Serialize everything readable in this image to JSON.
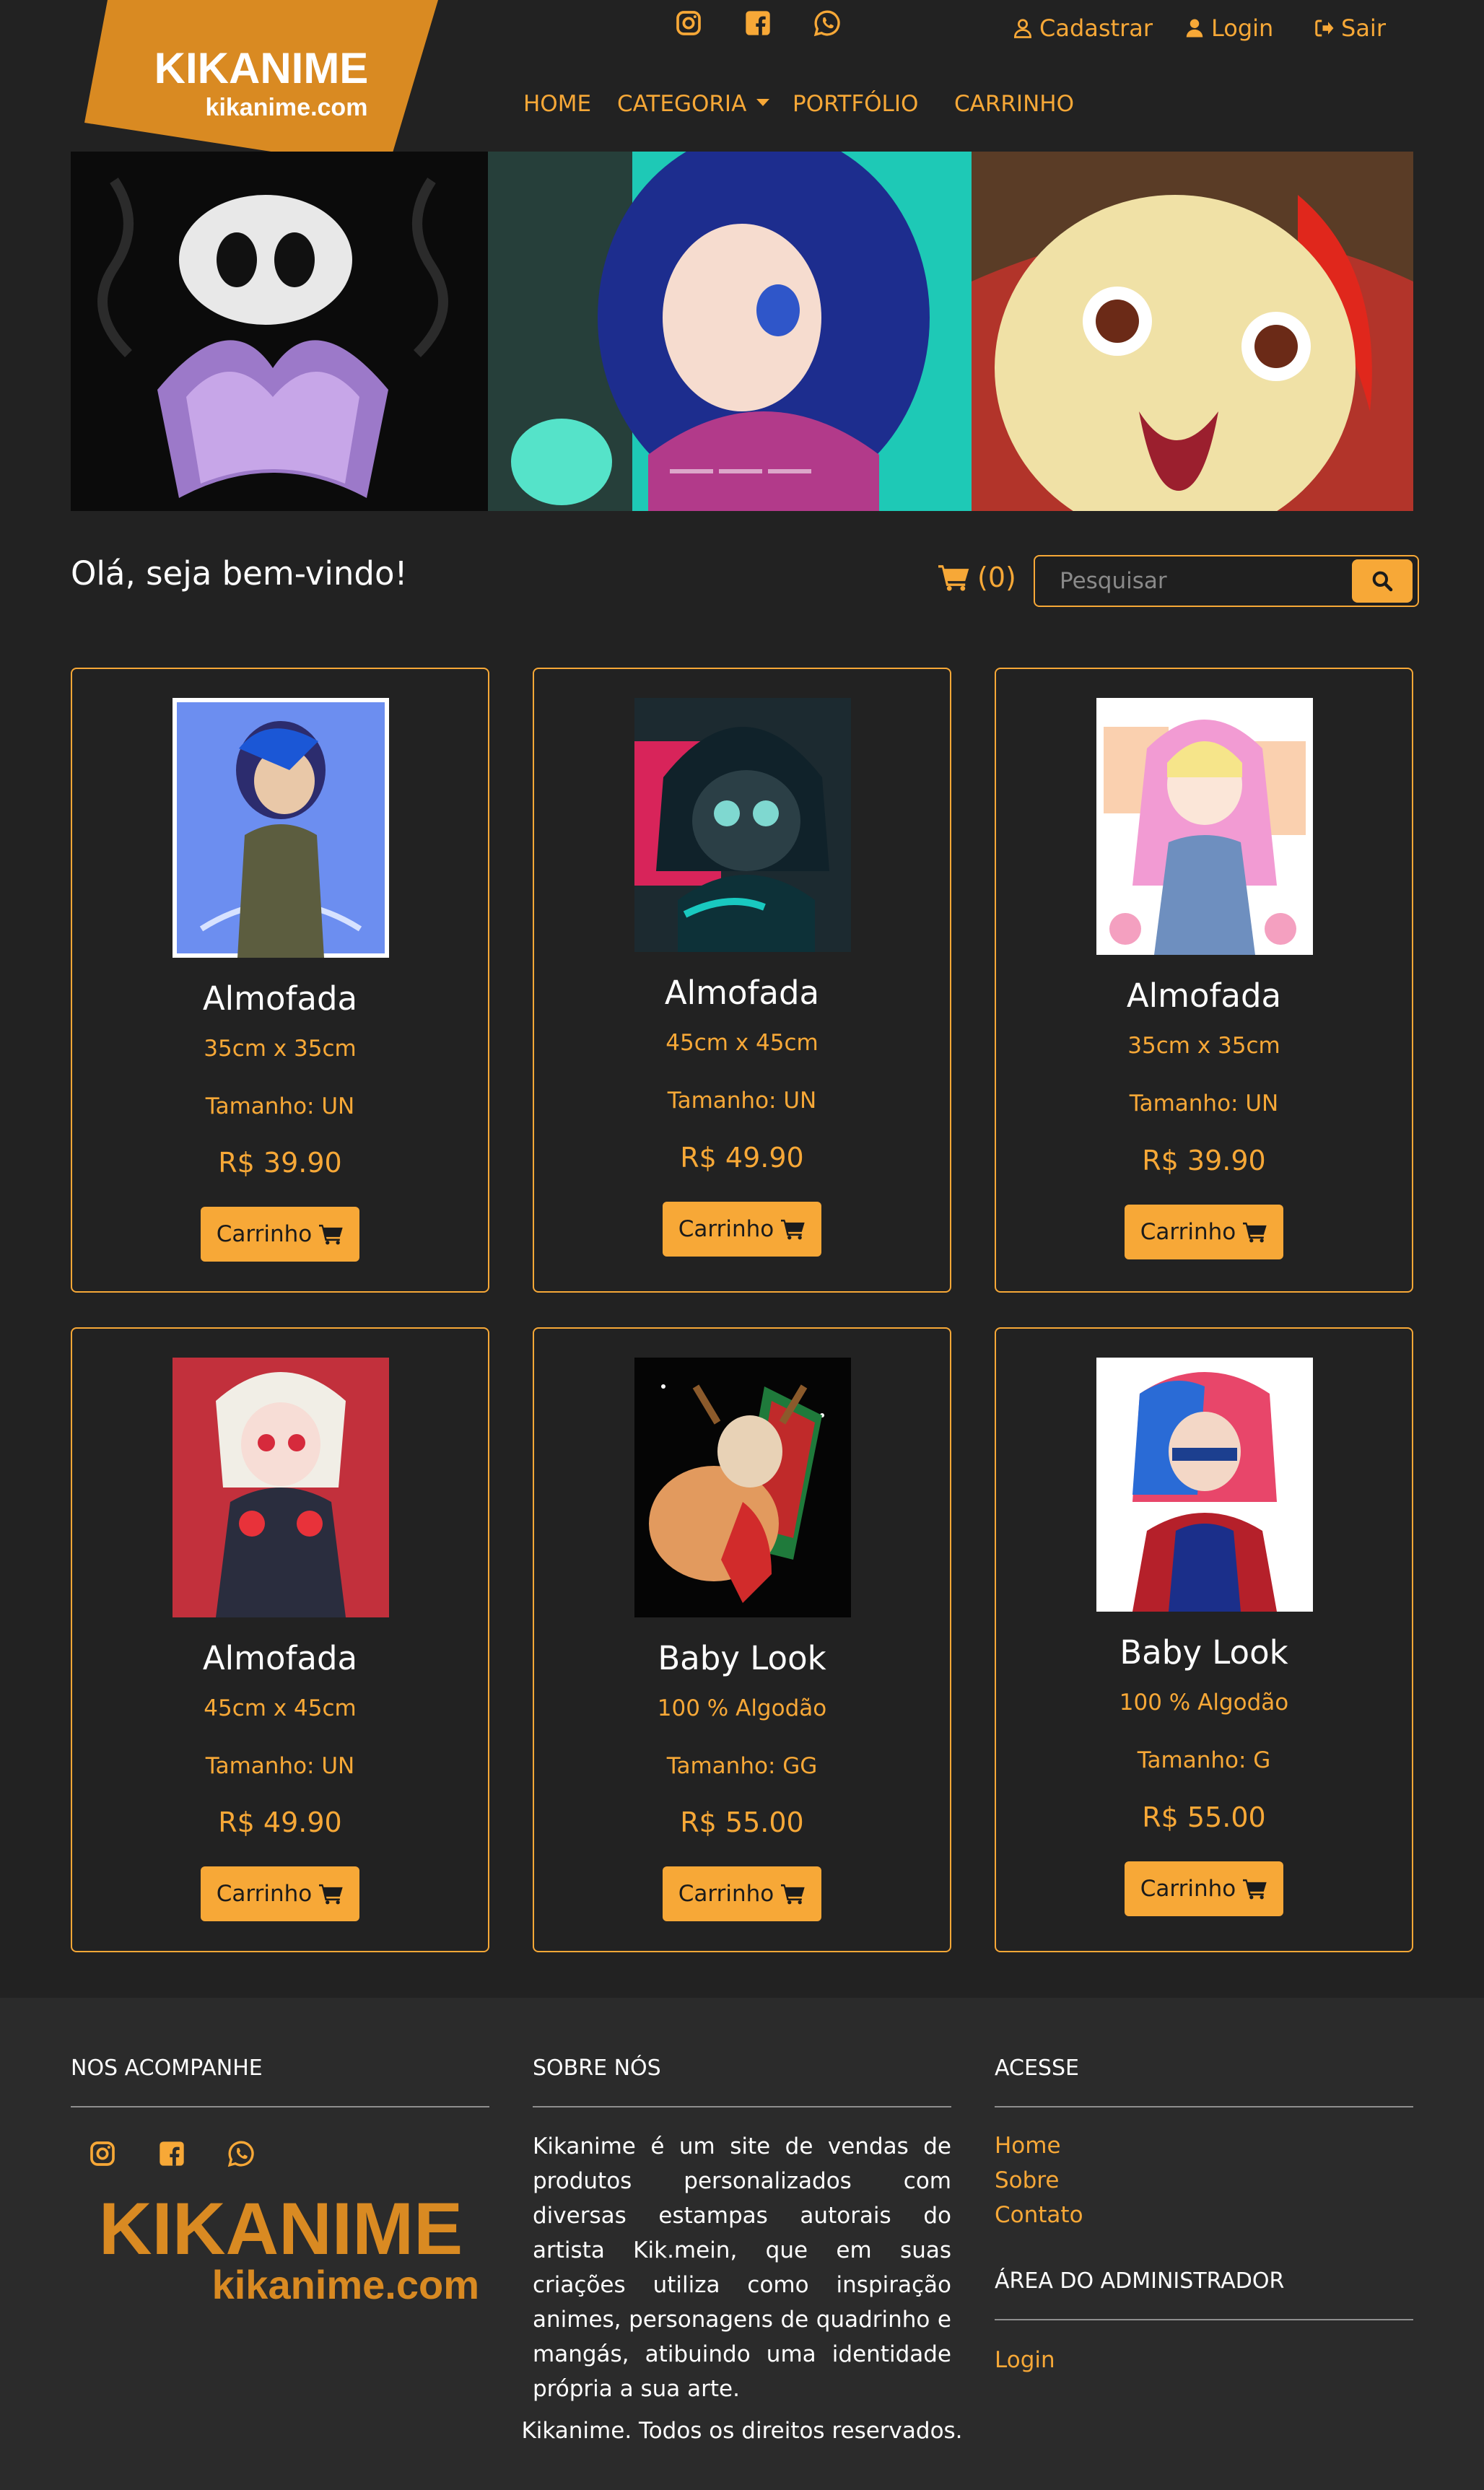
{
  "brand": {
    "name": "KIKANIME",
    "domain": "kikanime.com",
    "accent": "#f7a837",
    "background": "#222222"
  },
  "header": {
    "social_icons": [
      "instagram-icon",
      "facebook-icon",
      "whatsapp-icon"
    ],
    "auth": {
      "register": "Cadastrar",
      "login": "Login",
      "logout": "Sair"
    },
    "nav": {
      "home": "HOME",
      "category": "CATEGORIA",
      "portfolio": "PORTFÓLIO",
      "cart": "CARRINHO"
    }
  },
  "welcome": {
    "greeting": "Olá, seja bem-vindo!",
    "cart_count": "(0)",
    "search_placeholder": "Pesquisar"
  },
  "products": [
    {
      "name": "Almofada",
      "description": "35cm x 35cm",
      "size": "Tamanho: UN",
      "price": "R$ 39.90",
      "button": "Carrinho"
    },
    {
      "name": "Almofada",
      "description": "45cm x 45cm",
      "size": "Tamanho: UN",
      "price": "R$ 49.90",
      "button": "Carrinho"
    },
    {
      "name": "Almofada",
      "description": "35cm x 35cm",
      "size": "Tamanho: UN",
      "price": "R$ 39.90",
      "button": "Carrinho"
    },
    {
      "name": "Almofada",
      "description": "45cm x 45cm",
      "size": "Tamanho: UN",
      "price": "R$ 49.90",
      "button": "Carrinho"
    },
    {
      "name": "Baby Look",
      "description": "100 % Algodão",
      "size": "Tamanho: GG",
      "price": "R$ 55.00",
      "button": "Carrinho"
    },
    {
      "name": "Baby Look",
      "description": "100 % Algodão",
      "size": "Tamanho: G",
      "price": "R$ 55.00",
      "button": "Carrinho"
    }
  ],
  "footer": {
    "follow": {
      "heading": "NOS ACOMPANHE"
    },
    "about": {
      "heading": "SOBRE NÓS",
      "text": "Kikanime é um site de vendas de produtos personalizados com diversas estampas autorais do artista Kik.mein, que em suas criações utiliza como inspiração animes, personagens de quadrinho e mangás, atibuindo uma identidade própria a sua arte."
    },
    "access": {
      "heading": "ACESSE",
      "links": [
        "Home",
        "Sobre",
        "Contato"
      ]
    },
    "admin": {
      "heading": "ÁREA DO ADMINISTRADOR",
      "login": "Login"
    },
    "copyright": "Kikanime. Todos os direitos reservados."
  }
}
